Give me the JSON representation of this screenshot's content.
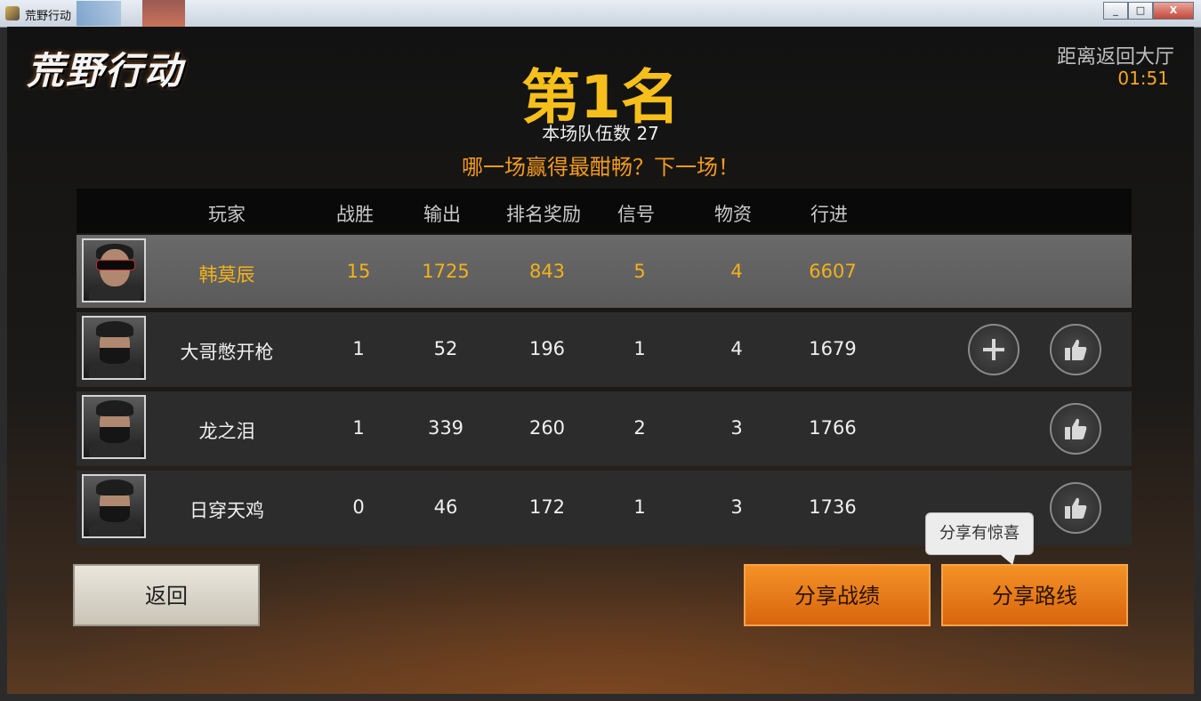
{
  "window": {
    "title": "荒野行动",
    "buttons": [
      "_",
      "□",
      "X"
    ]
  },
  "game": {
    "logo": "荒野行动",
    "countdown_label": "距离返回大厅",
    "countdown_time": "01:51",
    "rank_title": "第1名",
    "teams_label": "本场队伍数 27",
    "slogan": "哪一场赢得最酣畅？下一场！"
  },
  "table": {
    "headers": [
      "玩家",
      "战胜",
      "输出",
      "排名奖励",
      "信号",
      "物资",
      "行进"
    ],
    "rows": [
      {
        "name": "韩莫辰",
        "kills": "15",
        "damage": "1725",
        "rank_reward": "843",
        "signal": "5",
        "supplies": "4",
        "travel": "6607",
        "is_self": true
      },
      {
        "name": "大哥憋开枪",
        "kills": "1",
        "damage": "52",
        "rank_reward": "196",
        "signal": "1",
        "supplies": "4",
        "travel": "1679",
        "has_add": true,
        "has_like": true
      },
      {
        "name": "龙之泪",
        "kills": "1",
        "damage": "339",
        "rank_reward": "260",
        "signal": "2",
        "supplies": "3",
        "travel": "1766",
        "has_like": true
      },
      {
        "name": "日穿天鸡",
        "kills": "0",
        "damage": "46",
        "rank_reward": "172",
        "signal": "1",
        "supplies": "3",
        "travel": "1736",
        "has_like": true
      }
    ]
  },
  "buttons": {
    "back": "返回",
    "share_stats": "分享战绩",
    "share_route": "分享路线"
  },
  "tooltip": "分享有惊喜",
  "colors": {
    "accent_gold": "#f6bf1b",
    "accent_orange": "#f39b1c",
    "button_orange": "#e8781a"
  }
}
